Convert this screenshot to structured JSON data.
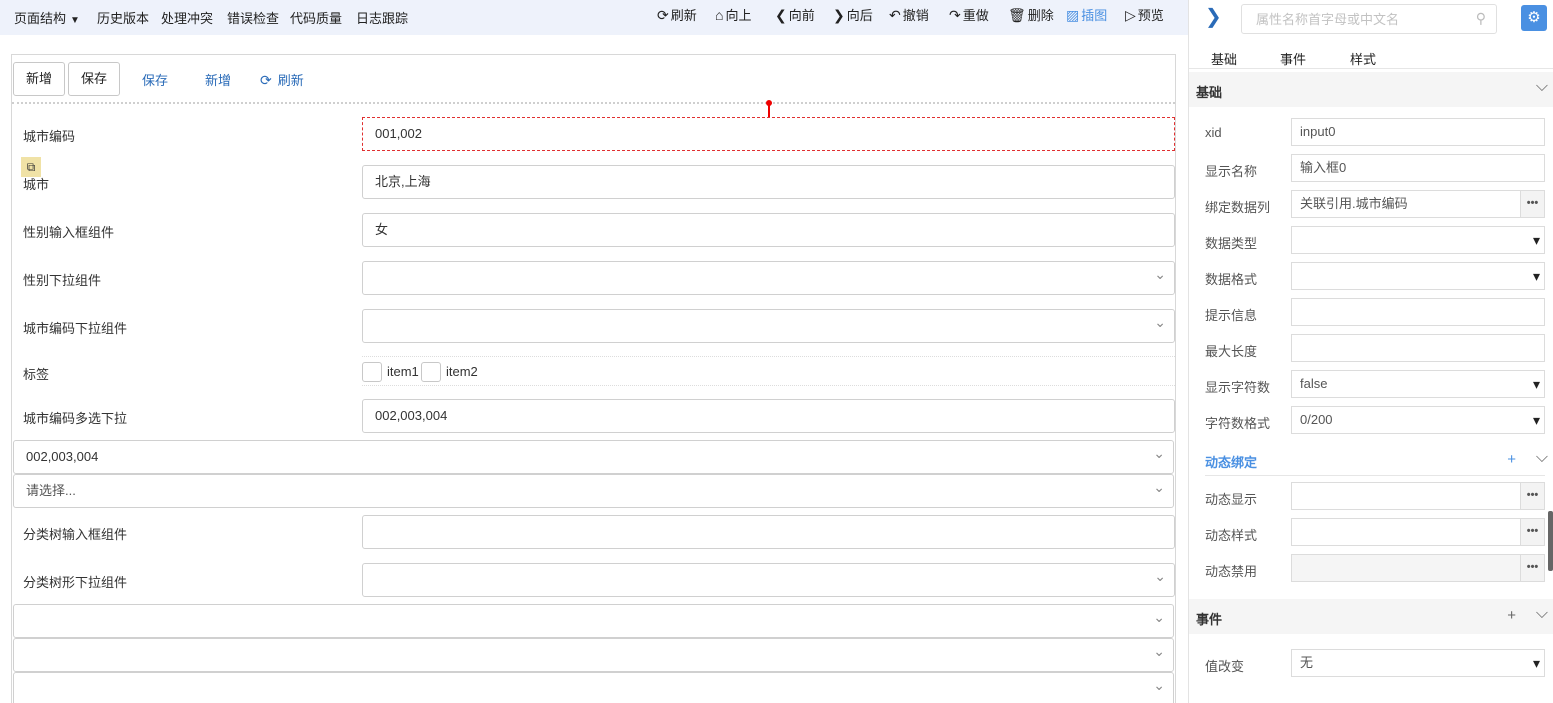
{
  "topbar": {
    "menus": [
      "页面结构",
      "历史版本",
      "处理冲突",
      "错误检查",
      "代码质量",
      "日志跟踪"
    ],
    "tools": [
      {
        "icon": "refresh-icon",
        "glyph": "⟳",
        "label": "刷新"
      },
      {
        "icon": "home-icon",
        "glyph": "⌂",
        "label": "向上"
      },
      {
        "icon": "arrow-left-icon",
        "glyph": "❮",
        "label": "向前"
      },
      {
        "icon": "arrow-right-icon",
        "glyph": "❯",
        "label": "向后"
      },
      {
        "icon": "undo-icon",
        "glyph": "↶",
        "label": "撤销"
      },
      {
        "icon": "redo-icon",
        "glyph": "↷",
        "label": "重做"
      },
      {
        "icon": "trash-icon",
        "glyph": "🗑",
        "label": "删除"
      },
      {
        "icon": "image-icon",
        "glyph": "▨",
        "label": "插图"
      },
      {
        "icon": "preview-icon",
        "glyph": "▷",
        "label": "预览"
      }
    ]
  },
  "canvas": {
    "buttons": [
      "新增",
      "保存"
    ],
    "links": [
      {
        "label": "保存"
      },
      {
        "label": "新增"
      },
      {
        "icon": "refresh-icon",
        "glyph": "⟳",
        "label": "刷新"
      }
    ],
    "copy_glyph": "⧉",
    "rows": [
      {
        "label": "城市编码",
        "value": "001,002"
      },
      {
        "label": "城市",
        "value": "北京,上海"
      },
      {
        "label": "性别输入框组件",
        "value": "女"
      },
      {
        "label": "性别下拉组件",
        "value": ""
      },
      {
        "label": "城市编码下拉组件",
        "value": ""
      },
      {
        "label": "标签",
        "items": [
          "item1",
          "item2"
        ]
      },
      {
        "label": "城市编码多选下拉",
        "value": "002,003,004"
      },
      {
        "label": "分类树输入框组件",
        "value": ""
      },
      {
        "label": "分类树形下拉组件",
        "value": ""
      }
    ],
    "full_selects": [
      "002,003,004",
      "请选择...",
      "",
      "",
      ""
    ]
  },
  "panel": {
    "search_placeholder": "属性名称首字母或中文名",
    "tabs": [
      "基础",
      "事件",
      "样式"
    ],
    "sections": {
      "basic": {
        "title": "基础",
        "props": [
          {
            "label": "xid",
            "value": "input0"
          },
          {
            "label": "显示名称",
            "value": "输入框0"
          },
          {
            "label": "绑定数据列",
            "value": "关联引用.城市编码"
          },
          {
            "label": "数据类型",
            "value": ""
          },
          {
            "label": "数据格式",
            "value": ""
          },
          {
            "label": "提示信息",
            "value": ""
          },
          {
            "label": "最大长度",
            "value": ""
          },
          {
            "label": "显示字符数",
            "value": "false"
          },
          {
            "label": "字符数格式",
            "value": "0/200"
          }
        ]
      },
      "dynamic": {
        "title": "动态绑定",
        "props": [
          {
            "label": "动态显示",
            "value": ""
          },
          {
            "label": "动态样式",
            "value": ""
          },
          {
            "label": "动态禁用",
            "value": ""
          }
        ]
      },
      "events": {
        "title": "事件",
        "props": [
          {
            "label": "值改变",
            "value": "无"
          }
        ]
      }
    },
    "accent_color": "#4a90e2",
    "dropdown_marker": "▾",
    "more_marker": "•••"
  }
}
